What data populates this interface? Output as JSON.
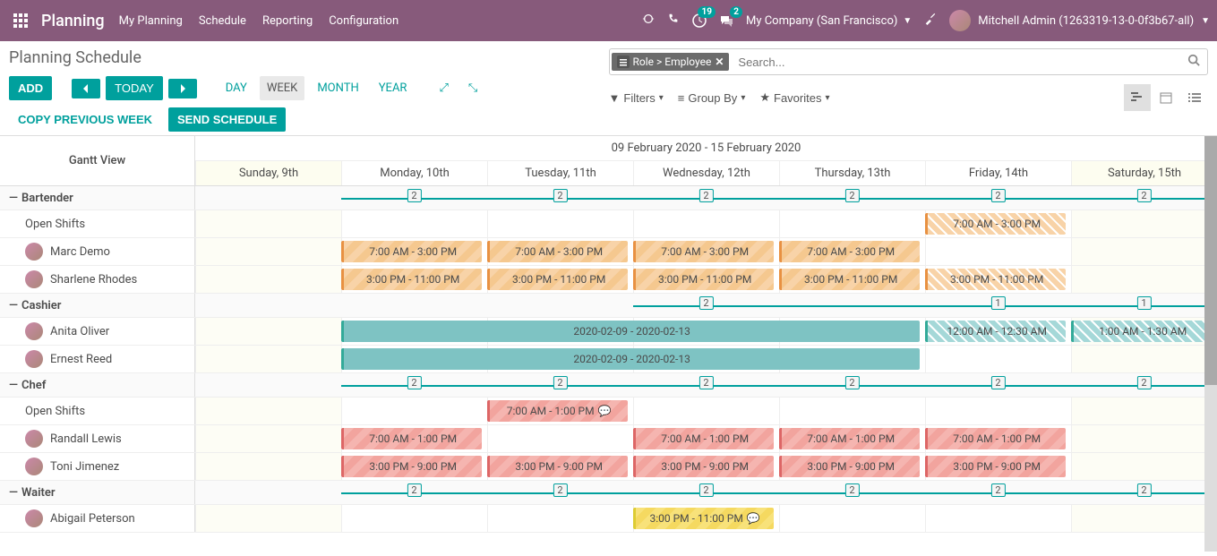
{
  "header": {
    "brand": "Planning",
    "menu": [
      "My Planning",
      "Schedule",
      "Reporting",
      "Configuration"
    ],
    "activity_count": "19",
    "discuss_count": "2",
    "company": "My Company (San Francisco)",
    "user": "Mitchell Admin (1263319-13-0-0f3b67-all)"
  },
  "page": {
    "title": "Planning Schedule",
    "add": "ADD",
    "today": "TODAY",
    "scales": {
      "day": "DAY",
      "week": "WEEK",
      "month": "MONTH",
      "year": "YEAR"
    },
    "copy": "COPY PREVIOUS WEEK",
    "send": "SEND SCHEDULE"
  },
  "search": {
    "tag": "Role > Employee",
    "placeholder": "Search..."
  },
  "filters": {
    "filters": "Filters",
    "groupby": "Group By",
    "favorites": "Favorites"
  },
  "gantt": {
    "label": "Gantt View",
    "range": "09 February 2020 - 15 February 2020",
    "days": [
      "Sunday, 9th",
      "Monday, 10th",
      "Tuesday, 11th",
      "Wednesday, 12th",
      "Thursday, 13th",
      "Friday, 14th",
      "Saturday, 15th"
    ]
  },
  "roles": {
    "bartender": {
      "name": "Bartender",
      "summary": [
        null,
        "2",
        "2",
        "2",
        "2",
        "2",
        "2",
        null
      ],
      "open": {
        "name": "Open Shifts",
        "shifts": [
          {
            "day": 5,
            "span": 1,
            "text": "7:00 AM - 3:00 PM",
            "style": "orange hatched"
          }
        ]
      },
      "marc": {
        "name": "Marc Demo",
        "shifts": [
          {
            "day": 1,
            "span": 1,
            "text": "7:00 AM - 3:00 PM",
            "style": "orange"
          },
          {
            "day": 2,
            "span": 1,
            "text": "7:00 AM - 3:00 PM",
            "style": "orange"
          },
          {
            "day": 3,
            "span": 1,
            "text": "7:00 AM - 3:00 PM",
            "style": "orange"
          },
          {
            "day": 4,
            "span": 1,
            "text": "7:00 AM - 3:00 PM",
            "style": "orange"
          }
        ]
      },
      "sharlene": {
        "name": "Sharlene Rhodes",
        "shifts": [
          {
            "day": 1,
            "span": 1,
            "text": "3:00 PM - 11:00 PM",
            "style": "orange"
          },
          {
            "day": 2,
            "span": 1,
            "text": "3:00 PM - 11:00 PM",
            "style": "orange"
          },
          {
            "day": 3,
            "span": 1,
            "text": "3:00 PM - 11:00 PM",
            "style": "orange"
          },
          {
            "day": 4,
            "span": 1,
            "text": "3:00 PM - 11:00 PM",
            "style": "orange"
          },
          {
            "day": 5,
            "span": 1,
            "text": "3:00 PM - 11:00 PM",
            "style": "orange hatched"
          }
        ]
      }
    },
    "cashier": {
      "name": "Cashier",
      "summary": [
        null,
        null,
        null,
        "2",
        null,
        "1",
        "1"
      ],
      "anita": {
        "name": "Anita Oliver",
        "shifts": [
          {
            "day": 1,
            "span": 4,
            "text": "2020-02-09 - 2020-02-13",
            "style": "teal"
          },
          {
            "day": 5,
            "span": 1,
            "text": "12:00 AM - 12:30 AM",
            "style": "teal hatched"
          },
          {
            "day": 6,
            "span": 1,
            "text": "1:00 AM - 1:30 AM",
            "style": "teal hatched"
          }
        ]
      },
      "ernest": {
        "name": "Ernest Reed",
        "shifts": [
          {
            "day": 1,
            "span": 4,
            "text": "2020-02-09 - 2020-02-13",
            "style": "teal"
          }
        ]
      }
    },
    "chef": {
      "name": "Chef",
      "summary": [
        null,
        "2",
        "2",
        "2",
        "2",
        "2",
        "2",
        null
      ],
      "open": {
        "name": "Open Shifts",
        "shifts": [
          {
            "day": 2,
            "span": 1,
            "text": "7:00 AM - 1:00 PM",
            "style": "red",
            "msg": true
          }
        ]
      },
      "randall": {
        "name": "Randall Lewis",
        "shifts": [
          {
            "day": 1,
            "span": 1,
            "text": "7:00 AM - 1:00 PM",
            "style": "red"
          },
          {
            "day": 3,
            "span": 1,
            "text": "7:00 AM - 1:00 PM",
            "style": "red"
          },
          {
            "day": 4,
            "span": 1,
            "text": "7:00 AM - 1:00 PM",
            "style": "red"
          },
          {
            "day": 5,
            "span": 1,
            "text": "7:00 AM - 1:00 PM",
            "style": "red"
          }
        ]
      },
      "toni": {
        "name": "Toni Jimenez",
        "shifts": [
          {
            "day": 1,
            "span": 1,
            "text": "3:00 PM - 9:00 PM",
            "style": "red"
          },
          {
            "day": 2,
            "span": 1,
            "text": "3:00 PM - 9:00 PM",
            "style": "red"
          },
          {
            "day": 3,
            "span": 1,
            "text": "3:00 PM - 9:00 PM",
            "style": "red"
          },
          {
            "day": 4,
            "span": 1,
            "text": "3:00 PM - 9:00 PM",
            "style": "red"
          },
          {
            "day": 5,
            "span": 1,
            "text": "3:00 PM - 9:00 PM",
            "style": "red"
          }
        ]
      }
    },
    "waiter": {
      "name": "Waiter",
      "summary": [
        null,
        "2",
        "2",
        "2",
        "2",
        "2",
        "2",
        null
      ],
      "abigail": {
        "name": "Abigail Peterson",
        "shifts": [
          {
            "day": 3,
            "span": 1,
            "text": "3:00 PM - 11:00 PM",
            "style": "yellow",
            "msg": true
          }
        ]
      }
    }
  }
}
